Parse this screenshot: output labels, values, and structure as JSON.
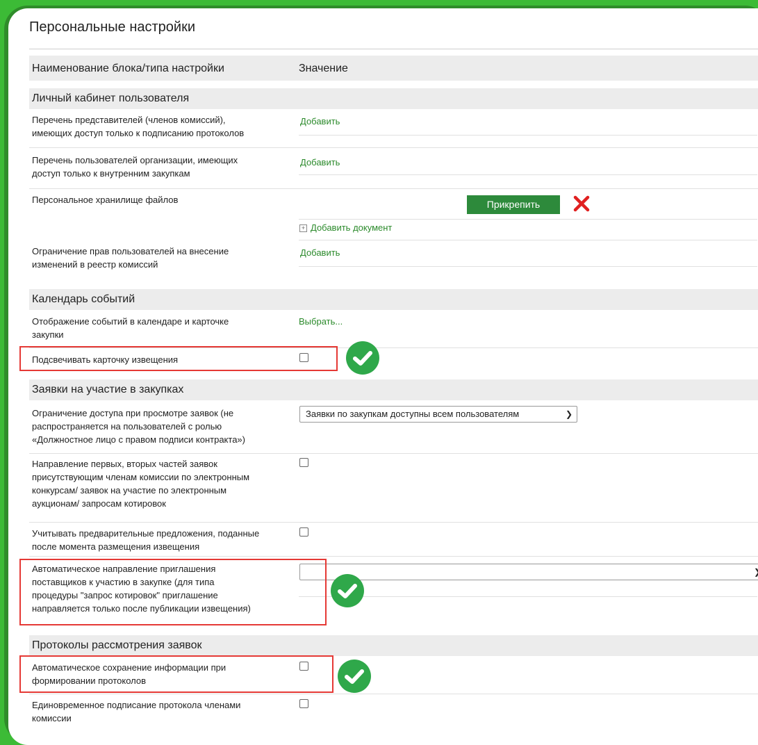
{
  "page": {
    "title": "Персональные настройки"
  },
  "columns": {
    "name": "Наименование блока/типа настройки",
    "value": "Значение"
  },
  "sections": {
    "s1": "Личный кабинет пользователя",
    "s2": "Календарь событий",
    "s3": "Заявки на участие в закупках",
    "s4": "Протоколы рассмотрения заявок"
  },
  "rows": {
    "r1": {
      "l1": "Перечень представителей (членов комиссий),",
      "l2": "имеющих доступ только к подписанию протоколов",
      "action": "Добавить"
    },
    "r2": {
      "l1": "Перечень пользователей организации, имеющих",
      "l2": "доступ только к внутренним закупкам",
      "action": "Добавить"
    },
    "r3": {
      "l1": "Персональное хранилище файлов",
      "attach": "Прикрепить",
      "add_doc": "Добавить документ"
    },
    "r4": {
      "l1": "Ограничение прав пользователей на внесение",
      "l2": "изменений в реестр комиссий",
      "action": "Добавить"
    },
    "r5": {
      "l1": "Отображение событий в календаре и карточке",
      "l2": "закупки",
      "action": "Выбрать..."
    },
    "r6": {
      "l1": "Подсвечивать карточку извещения"
    },
    "r7": {
      "l1": "Ограничение доступа при просмотре заявок (не",
      "l2": "распространяется на пользователей с ролью",
      "l3": "«Должностное лицо с правом подписи контракта»)",
      "select": "Заявки по закупкам доступны всем пользователям"
    },
    "r8": {
      "l1": "Направление первых, вторых частей заявок",
      "l2": "присутствующим членам комиссии по электронным",
      "l3": "конкурсам/ заявок на участие по электронным",
      "l4": "аукционам/ запросам котировок"
    },
    "r9": {
      "l1": "Учитывать предварительные предложения, поданные",
      "l2": "после момента размещения извещения"
    },
    "r10": {
      "l1": "Автоматическое направление приглашения",
      "l2": "поставщиков к участию в закупке (для типа",
      "l3": "процедуры \"запрос котировок\" приглашение",
      "l4": "направляется только после публикации извещения)",
      "select": ""
    },
    "r11": {
      "l1": "Автоматическое сохранение информации при",
      "l2": "формировании протоколов"
    },
    "r12": {
      "l1": "Единовременное подписание протокола членами",
      "l2": "комиссии"
    }
  },
  "colors": {
    "accent": "#2b8a2b",
    "highlight": "#e53935",
    "badge": "#2fa84a"
  }
}
